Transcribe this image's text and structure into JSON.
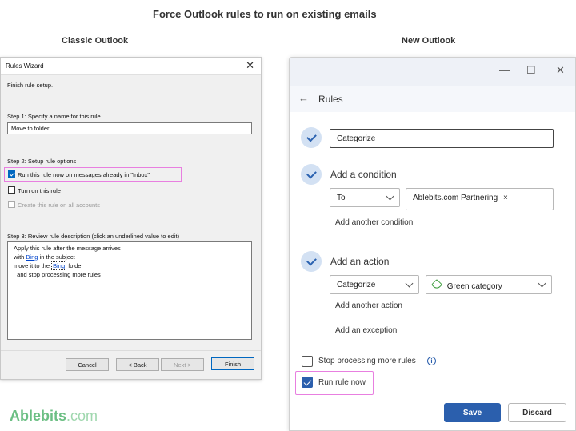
{
  "page_title": "Force Outlook rules to run on existing emails",
  "classic_heading": "Classic Outlook",
  "new_heading": "New Outlook",
  "classic": {
    "window_title": "Rules Wizard",
    "close_glyph": "✕",
    "intro": "Finish rule setup.",
    "step1_label": "Step 1: Specify a name for this rule",
    "rule_name": "Move to folder",
    "step2_label": "Step 2: Setup rule options",
    "options": [
      {
        "label": "Run this rule now on messages already in \"Inbox\"",
        "checked": true,
        "enabled": true
      },
      {
        "label": "Turn on this rule",
        "checked": false,
        "enabled": true
      },
      {
        "label": "Create this rule on all accounts",
        "checked": false,
        "enabled": false
      }
    ],
    "step3_label": "Step 3: Review rule description (click an underlined value to edit)",
    "description": {
      "line1": "Apply this rule after the message arrives",
      "line2_pre": "with ",
      "line2_link": "Bing",
      "line2_post": " in the subject",
      "line3_pre": "move it to the ",
      "line3_link": "Bing",
      "line3_post": " folder",
      "line4": "  and stop processing more rules"
    },
    "buttons": {
      "cancel": "Cancel",
      "back": "< Back",
      "next": "Next >",
      "finish": "Finish"
    }
  },
  "new": {
    "window_controls": {
      "minimize": "—",
      "maximize": "☐",
      "close": "✕"
    },
    "back_glyph": "←",
    "header_title": "Rules",
    "rule_name": "Categorize",
    "condition_label": "Add a condition",
    "condition_field": "To",
    "condition_value": "Ablebits.com Partnering",
    "remove_glyph": "×",
    "add_condition": "Add another condition",
    "action_label": "Add an action",
    "action_field": "Categorize",
    "action_value": "Green category",
    "add_action": "Add another action",
    "add_exception": "Add an exception",
    "stop_processing": {
      "label": "Stop processing more rules",
      "checked": false
    },
    "info_glyph": "i",
    "run_now": {
      "label": "Run rule now",
      "checked": true
    },
    "save": "Save",
    "discard": "Discard"
  },
  "logo": {
    "part1": "Ablebits",
    "part2": ".com"
  },
  "colors": {
    "highlight": "#e87fe0",
    "accent": "#2b5fad",
    "classic_accent": "#0067c0",
    "logo": "#6cbf84"
  }
}
